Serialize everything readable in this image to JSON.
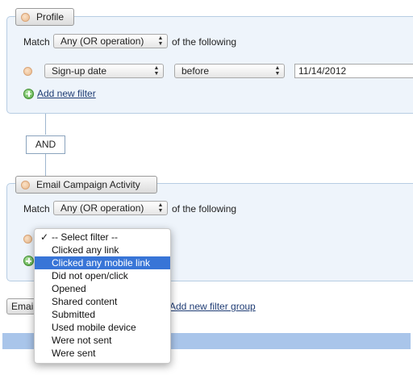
{
  "profile_group": {
    "tab_label": "Profile",
    "match_label": "Match",
    "match_value": "Any (OR operation)",
    "match_suffix": "of the following",
    "filter": {
      "field": "Sign-up date",
      "operator": "before",
      "value": "11/14/2012"
    },
    "add_filter_label": "Add new filter"
  },
  "connector": {
    "and_label": "AND"
  },
  "email_group": {
    "tab_label": "Email Campaign Activity",
    "match_label": "Match",
    "match_value": "Any (OR operation)",
    "match_suffix": "of the following"
  },
  "footer": {
    "add_group_button_partial": "Emai",
    "add_group_link": "Add new filter group"
  },
  "dropdown": {
    "options": [
      "-- Select filter --",
      "Clicked any link",
      "Clicked any mobile link",
      "Did not open/click",
      "Opened",
      "Shared content",
      "Submitted",
      "Used mobile device",
      "Were not sent",
      "Were sent"
    ],
    "checked_mark": "✓",
    "highlighted_index": 2,
    "checked_index": 0
  },
  "colors": {
    "group_background": "#eef4fb",
    "group_border": "#b7cde3",
    "highlight": "#3875d7",
    "bottom_bar": "#a9c5ea",
    "link": "#1f3c74"
  },
  "icons": {
    "remove": "remove-circle-icon",
    "add": "plus-circle-icon",
    "select": "updown-arrows-icon",
    "check": "checkmark-icon"
  }
}
